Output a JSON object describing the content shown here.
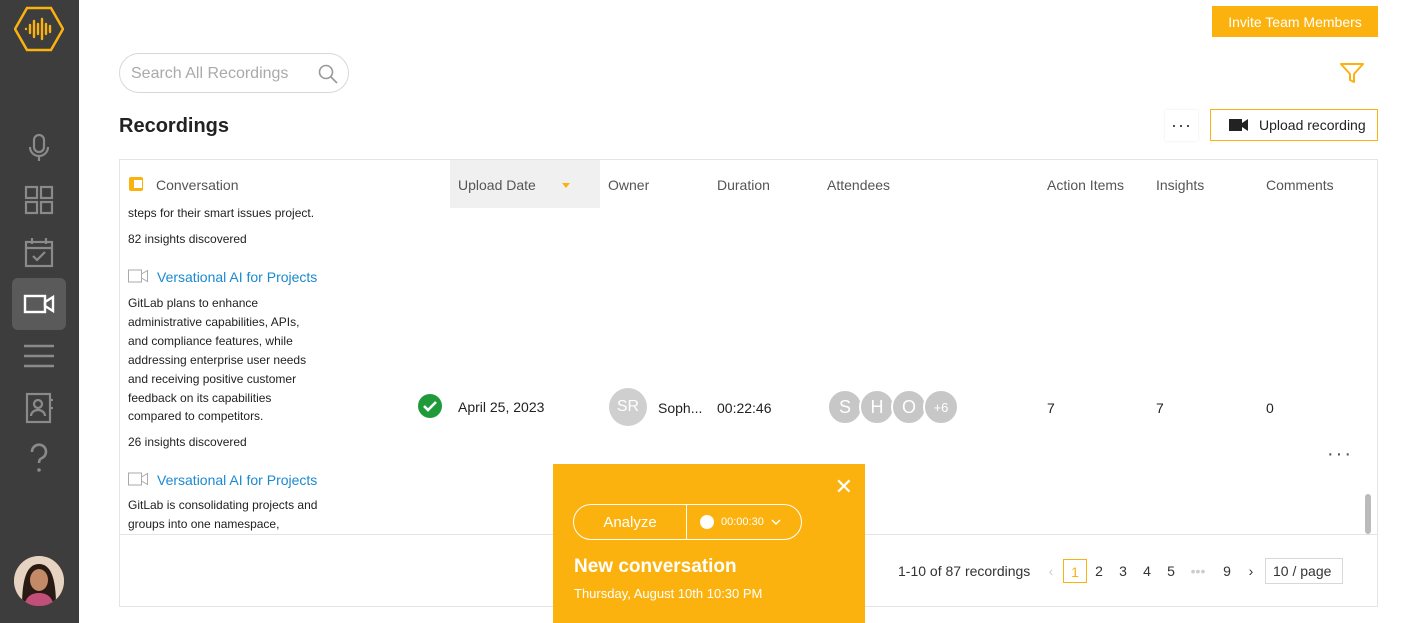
{
  "sidebar": {
    "logo": "waveform-logo-icon",
    "items": [
      {
        "name": "microphone-icon",
        "active": false
      },
      {
        "name": "grid-icon",
        "active": false
      },
      {
        "name": "calendar-check-icon",
        "active": false
      },
      {
        "name": "video-camera-icon",
        "active": true
      },
      {
        "name": "list-icon",
        "active": false
      },
      {
        "name": "contacts-icon",
        "active": false
      },
      {
        "name": "help-icon",
        "active": false
      }
    ]
  },
  "header": {
    "invite_label": "Invite Team Members",
    "search_placeholder": "Search All Recordings",
    "title": "Recordings",
    "more_label": "···",
    "upload_label": "Upload recording"
  },
  "table": {
    "columns": {
      "conversation": "Conversation",
      "upload_date": "Upload Date",
      "owner": "Owner",
      "duration": "Duration",
      "attendees": "Attendees",
      "action_items": "Action Items",
      "insights": "Insights",
      "comments": "Comments"
    },
    "prev_row": {
      "summary_tail": "steps for their smart issues project.",
      "insights": "82 insights discovered"
    },
    "row": {
      "title": "Versational AI for Projects",
      "summary_lines": [
        "GitLab plans to enhance",
        "administrative capabilities, APIs,",
        "and compliance features, while",
        "addressing enterprise user needs",
        "and receiving positive customer",
        "feedback on its capabilities",
        "compared to competitors."
      ],
      "insights": "26 insights discovered",
      "upload_date": "April 25, 2023",
      "owner_initials": "SR",
      "owner_name": "Soph...",
      "duration": "00:22:46",
      "attendees": [
        "S",
        "H",
        "O",
        "+6"
      ],
      "action_items": "7",
      "insights_count": "7",
      "comments": "0",
      "more_label": "···"
    },
    "next_row": {
      "title": "Versational AI for Projects",
      "summary_lines": [
        "GitLab is consolidating projects and",
        "groups into one namespace,"
      ]
    }
  },
  "pagination": {
    "summary": "1-10 of 87 recordings",
    "prev": "‹",
    "pages": [
      "1",
      "2",
      "3",
      "4",
      "5",
      "•••",
      "9"
    ],
    "next": "›",
    "page_size": "10 / page"
  },
  "popup": {
    "close": "✕",
    "analyze_label": "Analyze",
    "timer": "00:00:30",
    "title": "New conversation",
    "date": "Thursday, August 10th 10:30 PM"
  },
  "colors": {
    "accent": "#fbb20f",
    "link": "#1a8ad0",
    "sidebar": "#3d3d3d",
    "success": "#1f9a3a"
  }
}
